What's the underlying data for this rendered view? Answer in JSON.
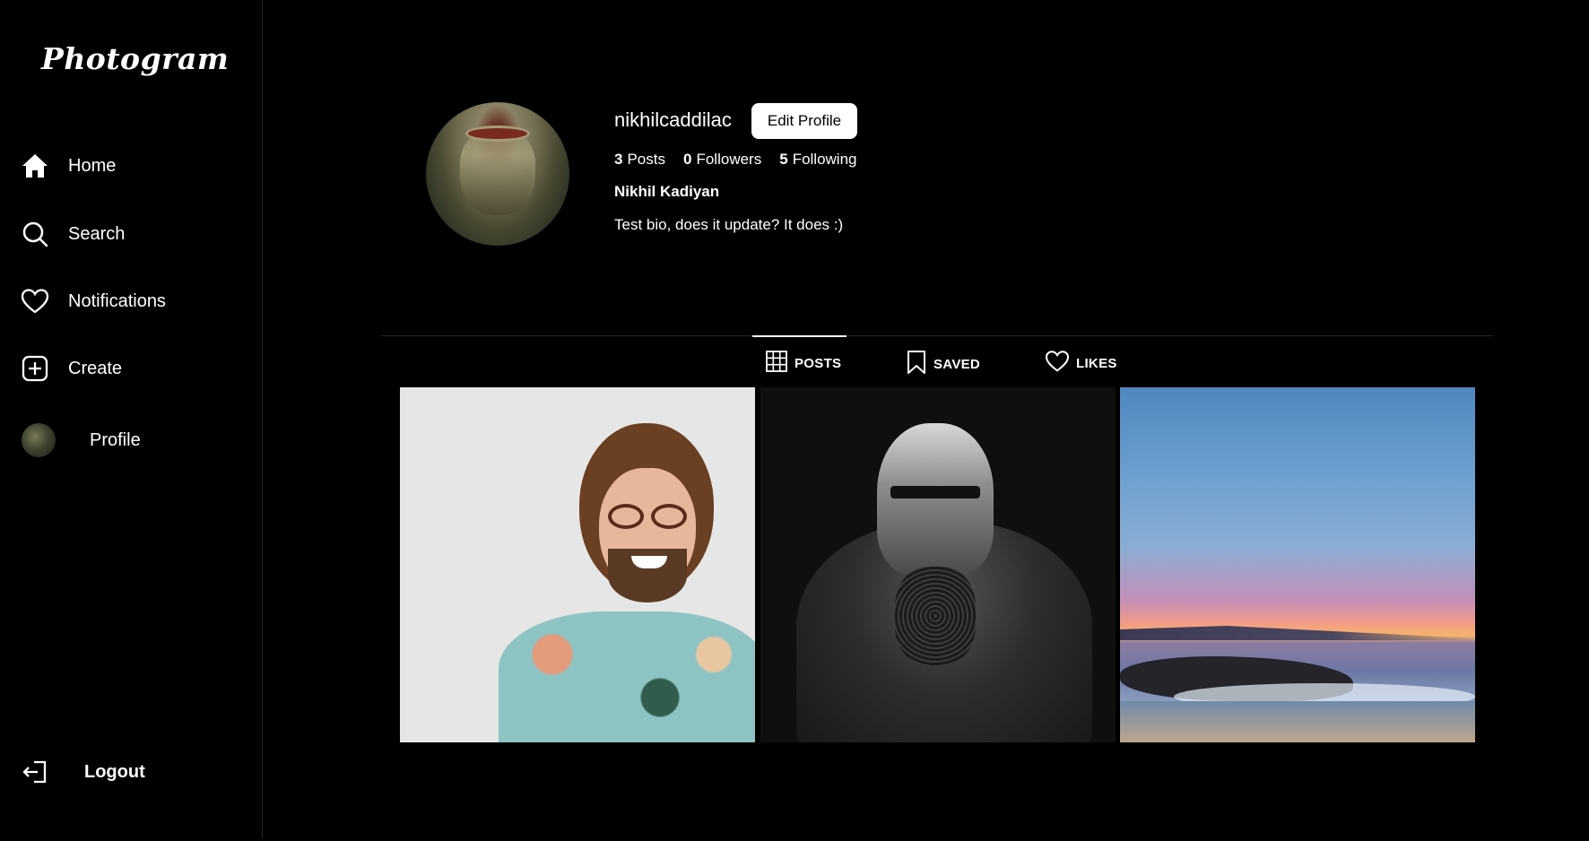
{
  "app": {
    "logo": "Photogram"
  },
  "sidebar": {
    "items": [
      {
        "label": "Home",
        "icon": "home-icon"
      },
      {
        "label": "Search",
        "icon": "search-icon"
      },
      {
        "label": "Notifications",
        "icon": "heart-icon"
      },
      {
        "label": "Create",
        "icon": "plus-square-icon"
      },
      {
        "label": "Profile",
        "icon": "avatar"
      }
    ],
    "logout": {
      "label": "Logout",
      "icon": "logout-icon"
    }
  },
  "profile": {
    "username": "nikhilcaddilac",
    "edit_label": "Edit Profile",
    "stats": {
      "posts_count": "3",
      "posts_label": "Posts",
      "followers_count": "0",
      "followers_label": "Followers",
      "following_count": "5",
      "following_label": "Following"
    },
    "full_name": "Nikhil Kadiyan",
    "bio": "Test bio, does it update? It does :)"
  },
  "tabs": [
    {
      "label": "POSTS",
      "icon": "grid-icon",
      "active": true
    },
    {
      "label": "SAVED",
      "icon": "bookmark-icon",
      "active": false
    },
    {
      "label": "LIKES",
      "icon": "heart-icon",
      "active": false
    }
  ],
  "posts": [
    {
      "subject": "man-with-glasses-photo"
    },
    {
      "subject": "armored-knight-illustration"
    },
    {
      "subject": "beach-sunset-photo"
    }
  ],
  "colors": {
    "background": "#000000",
    "text": "#ffffff",
    "border": "#262626",
    "button_bg": "#ffffff",
    "button_text": "#000000"
  }
}
